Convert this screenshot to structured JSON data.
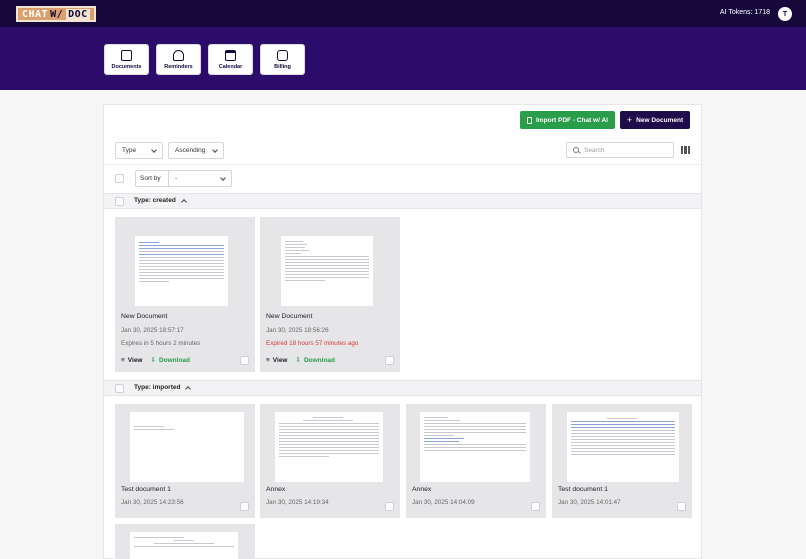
{
  "header": {
    "logo_text_1": "CHAT",
    "logo_text_2": "W/",
    "logo_text_3": "DOC",
    "tokens": "AI Tokens: 1718",
    "avatar": "T"
  },
  "nav": [
    {
      "label": "Documents",
      "icon": "documents-icon"
    },
    {
      "label": "Reminders",
      "icon": "reminders-icon"
    },
    {
      "label": "Calendar",
      "icon": "calendar-icon"
    },
    {
      "label": "Billing",
      "icon": "billing-icon"
    }
  ],
  "toolbar": {
    "import_label": "Import PDF - Chat w/ AI",
    "new_label": "New Document",
    "type_value": "Type",
    "order_value": "Ascending",
    "search_placeholder": "Search",
    "sortby_label": "Sort by",
    "sortby_value": "-"
  },
  "colors": {
    "header": "#16083b",
    "hero": "#2c0c6b",
    "import": "#2a9d4a",
    "new": "#1d0d4a",
    "expired": "#d33b3b"
  },
  "groups": {
    "created": {
      "label": "Type: created",
      "cards": [
        {
          "title": "New Document",
          "date": "Jan 30, 2025 18:57:17",
          "expiry": "Expires in 5 hours 2 minutes",
          "view": "View",
          "download": "Download"
        },
        {
          "title": "New Document",
          "date": "Jan 30, 2025 18:56:26",
          "expiry": "Expired 18 hours 57 minutes ago",
          "view": "View",
          "download": "Download"
        }
      ]
    },
    "imported": {
      "label": "Type: imported",
      "cards": [
        {
          "title": "Test document 1",
          "date": "Jan 30, 2025 14:23:56"
        },
        {
          "title": "Annex",
          "date": "Jan 30, 2025 14:19:34"
        },
        {
          "title": "Annex",
          "date": "Jan 30, 2025 14:04:09"
        },
        {
          "title": "Test document 1",
          "date": "Jan 30, 2025 14:01:47"
        }
      ]
    }
  }
}
